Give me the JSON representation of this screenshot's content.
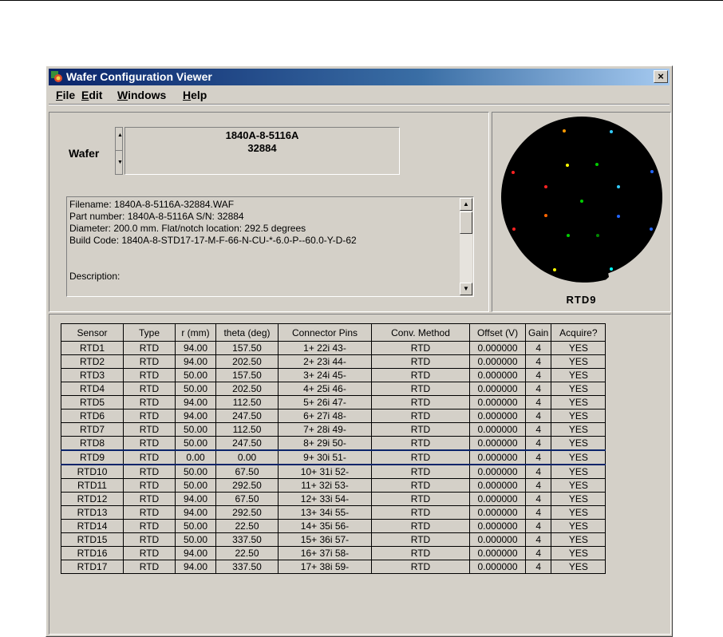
{
  "window": {
    "title": "Wafer Configuration Viewer",
    "close_label": "×"
  },
  "menu": [
    {
      "acc": "F",
      "rest": "ile"
    },
    {
      "acc": "E",
      "rest": "dit"
    },
    {
      "acc": "W",
      "rest": "indows"
    },
    {
      "acc": "H",
      "rest": "elp"
    }
  ],
  "wafer": {
    "label": "Wafer",
    "line1": "1840A-8-5116A",
    "line2": "32884"
  },
  "info_lines": [
    "Filename:  1840A-8-5116A-32884.WAF",
    "Part number:  1840A-8-5116A        S/N:  32884",
    "Diameter:  200.0 mm.      Flat/notch location:  292.5 degrees",
    "Build Code:  1840A-8-STD17-17-M-F-66-N-CU-*-6.0-P--60.0-Y-D-62",
    "",
    "Description:"
  ],
  "map": {
    "label": "RTD9"
  },
  "table": {
    "headers": [
      "Sensor",
      "Type",
      "r (mm)",
      "theta (deg)",
      "Connector Pins",
      "Conv. Method",
      "Offset (V)",
      "Gain",
      "Acquire?"
    ],
    "selected_index": 8,
    "rows": [
      [
        "RTD1",
        "RTD",
        "94.00",
        "157.50",
        "1+  22i  43-",
        "RTD",
        "0.000000",
        "4",
        "YES"
      ],
      [
        "RTD2",
        "RTD",
        "94.00",
        "202.50",
        "2+  23i  44-",
        "RTD",
        "0.000000",
        "4",
        "YES"
      ],
      [
        "RTD3",
        "RTD",
        "50.00",
        "157.50",
        "3+  24i  45-",
        "RTD",
        "0.000000",
        "4",
        "YES"
      ],
      [
        "RTD4",
        "RTD",
        "50.00",
        "202.50",
        "4+  25i  46-",
        "RTD",
        "0.000000",
        "4",
        "YES"
      ],
      [
        "RTD5",
        "RTD",
        "94.00",
        "112.50",
        "5+  26i  47-",
        "RTD",
        "0.000000",
        "4",
        "YES"
      ],
      [
        "RTD6",
        "RTD",
        "94.00",
        "247.50",
        "6+  27i  48-",
        "RTD",
        "0.000000",
        "4",
        "YES"
      ],
      [
        "RTD7",
        "RTD",
        "50.00",
        "112.50",
        "7+  28i  49-",
        "RTD",
        "0.000000",
        "4",
        "YES"
      ],
      [
        "RTD8",
        "RTD",
        "50.00",
        "247.50",
        "8+  29i  50-",
        "RTD",
        "0.000000",
        "4",
        "YES"
      ],
      [
        "RTD9",
        "RTD",
        "0.00",
        "0.00",
        "9+  30i  51-",
        "RTD",
        "0.000000",
        "4",
        "YES"
      ],
      [
        "RTD10",
        "RTD",
        "50.00",
        "67.50",
        "10+  31i  52-",
        "RTD",
        "0.000000",
        "4",
        "YES"
      ],
      [
        "RTD11",
        "RTD",
        "50.00",
        "292.50",
        "11+  32i  53-",
        "RTD",
        "0.000000",
        "4",
        "YES"
      ],
      [
        "RTD12",
        "RTD",
        "94.00",
        "67.50",
        "12+  33i  54-",
        "RTD",
        "0.000000",
        "4",
        "YES"
      ],
      [
        "RTD13",
        "RTD",
        "94.00",
        "292.50",
        "13+  34i  55-",
        "RTD",
        "0.000000",
        "4",
        "YES"
      ],
      [
        "RTD14",
        "RTD",
        "50.00",
        "22.50",
        "14+  35i  56-",
        "RTD",
        "0.000000",
        "4",
        "YES"
      ],
      [
        "RTD15",
        "RTD",
        "50.00",
        "337.50",
        "15+  36i  57-",
        "RTD",
        "0.000000",
        "4",
        "YES"
      ],
      [
        "RTD16",
        "RTD",
        "94.00",
        "22.50",
        "16+  37i  58-",
        "RTD",
        "0.000000",
        "4",
        "YES"
      ],
      [
        "RTD17",
        "RTD",
        "94.00",
        "337.50",
        "17+  38i  59-",
        "RTD",
        "0.000000",
        "4",
        "YES"
      ]
    ]
  },
  "sensor_colors": [
    "#ff9900",
    "#33ccff",
    "#00cc00",
    "#ff2222",
    "#ffff00",
    "#2266ff",
    "#008800",
    "#ff6600",
    "#00ffff"
  ],
  "colors": {
    "titlebar_start": "#0a246a",
    "face": "#d4d0c8",
    "map_bg": "#000000"
  }
}
